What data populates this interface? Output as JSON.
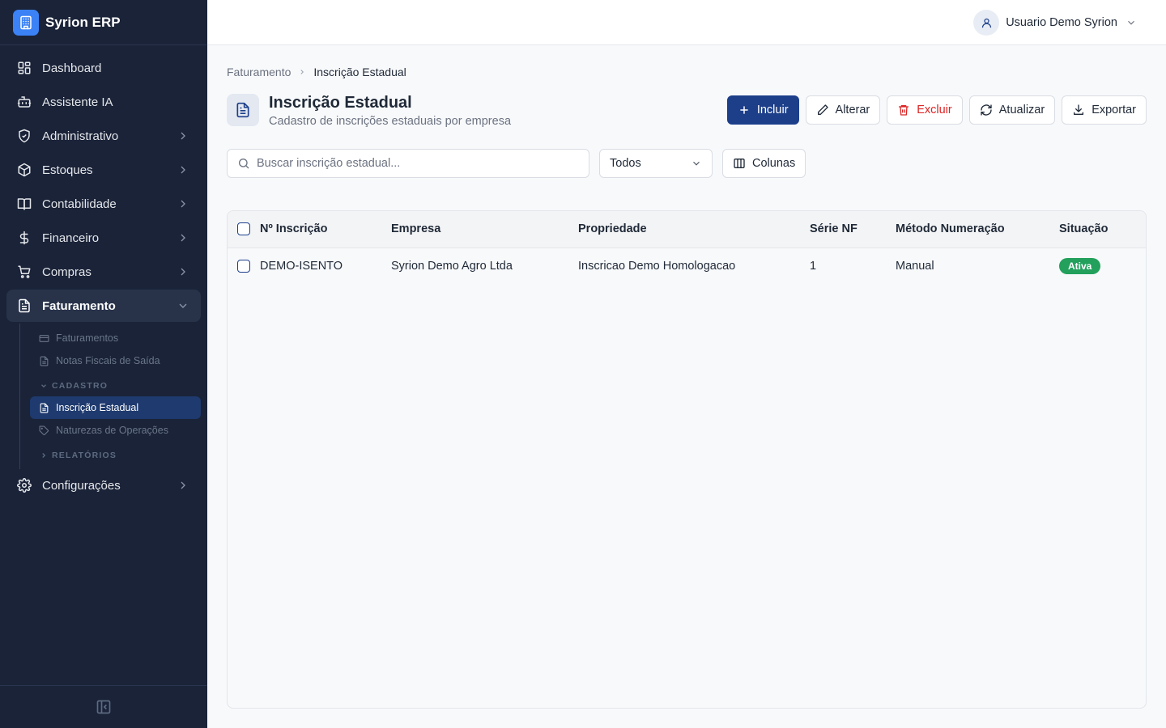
{
  "app": {
    "name": "Syrion ERP"
  },
  "sidebar": {
    "items": [
      {
        "label": "Dashboard",
        "icon": "dashboard-icon",
        "chevron": false
      },
      {
        "label": "Assistente IA",
        "icon": "bot-icon",
        "chevron": false
      },
      {
        "label": "Administrativo",
        "icon": "shield-icon",
        "chevron": true
      },
      {
        "label": "Estoques",
        "icon": "box-icon",
        "chevron": true
      },
      {
        "label": "Contabilidade",
        "icon": "book-icon",
        "chevron": true
      },
      {
        "label": "Financeiro",
        "icon": "dollar-icon",
        "chevron": true
      },
      {
        "label": "Compras",
        "icon": "cart-icon",
        "chevron": true
      },
      {
        "label": "Faturamento",
        "icon": "document-icon",
        "chevron": true,
        "active": true
      },
      {
        "label": "Configurações",
        "icon": "gear-icon",
        "chevron": true
      }
    ],
    "faturamento_sub": {
      "items": [
        {
          "label": "Faturamentos",
          "icon": "card-icon"
        },
        {
          "label": "Notas Fiscais de Saída",
          "icon": "file-icon"
        }
      ],
      "group_cadastro": "CADASTRO",
      "cadastro_items": [
        {
          "label": "Inscrição Estadual",
          "icon": "file-icon",
          "active": true
        },
        {
          "label": "Naturezas de Operações",
          "icon": "tag-icon"
        }
      ],
      "group_relatorios": "RELATÓRIOS"
    }
  },
  "header": {
    "user_name": "Usuario Demo Syrion"
  },
  "breadcrumb": {
    "parent": "Faturamento",
    "current": "Inscrição Estadual"
  },
  "page": {
    "title": "Inscrição Estadual",
    "subtitle": "Cadastro de inscrições estaduais por empresa"
  },
  "toolbar": {
    "incluir": "Incluir",
    "alterar": "Alterar",
    "excluir": "Excluir",
    "atualizar": "Atualizar",
    "exportar": "Exportar"
  },
  "filters": {
    "search_placeholder": "Buscar inscrição estadual...",
    "status_selected": "Todos",
    "columns_label": "Colunas"
  },
  "table": {
    "columns": [
      "Nº Inscrição",
      "Empresa",
      "Propriedade",
      "Série NF",
      "Método Numeração",
      "Situação"
    ],
    "rows": [
      {
        "inscricao": "DEMO-ISENTO",
        "empresa": "Syrion Demo Agro Ltda",
        "propriedade": "Inscricao Demo Homologacao",
        "serie": "1",
        "metodo": "Manual",
        "situacao": "Ativa"
      }
    ]
  },
  "colors": {
    "sidebar_bg": "#1a2338",
    "primary": "#1d3f8a",
    "danger": "#dc2626",
    "success": "#22a05c",
    "brand_logo": "#3b82f6"
  }
}
